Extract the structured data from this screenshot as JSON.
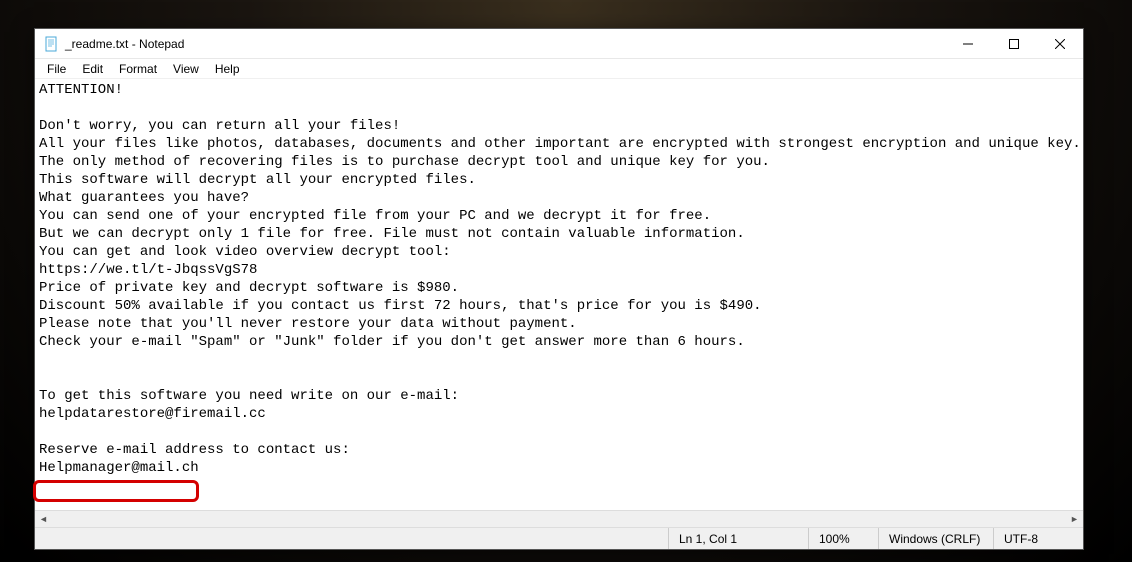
{
  "window": {
    "title": "_readme.txt - Notepad"
  },
  "menu": {
    "file": "File",
    "edit": "Edit",
    "format": "Format",
    "view": "View",
    "help": "Help"
  },
  "content": {
    "text": "ATTENTION!\n\nDon't worry, you can return all your files!\nAll your files like photos, databases, documents and other important are encrypted with strongest encryption and unique key.\nThe only method of recovering files is to purchase decrypt tool and unique key for you.\nThis software will decrypt all your encrypted files.\nWhat guarantees you have?\nYou can send one of your encrypted file from your PC and we decrypt it for free.\nBut we can decrypt only 1 file for free. File must not contain valuable information.\nYou can get and look video overview decrypt tool:\nhttps://we.tl/t-JbqssVgS78\nPrice of private key and decrypt software is $980.\nDiscount 50% available if you contact us first 72 hours, that's price for you is $490.\nPlease note that you'll never restore your data without payment.\nCheck your e-mail \"Spam\" or \"Junk\" folder if you don't get answer more than 6 hours.\n\n\nTo get this software you need write on our e-mail:\nhelpdatarestore@firemail.cc\n\nReserve e-mail address to contact us:\nHelpmanager@mail.ch"
  },
  "status": {
    "position": "Ln 1, Col 1",
    "zoom": "100%",
    "eol": "Windows (CRLF)",
    "encoding": "UTF-8"
  }
}
